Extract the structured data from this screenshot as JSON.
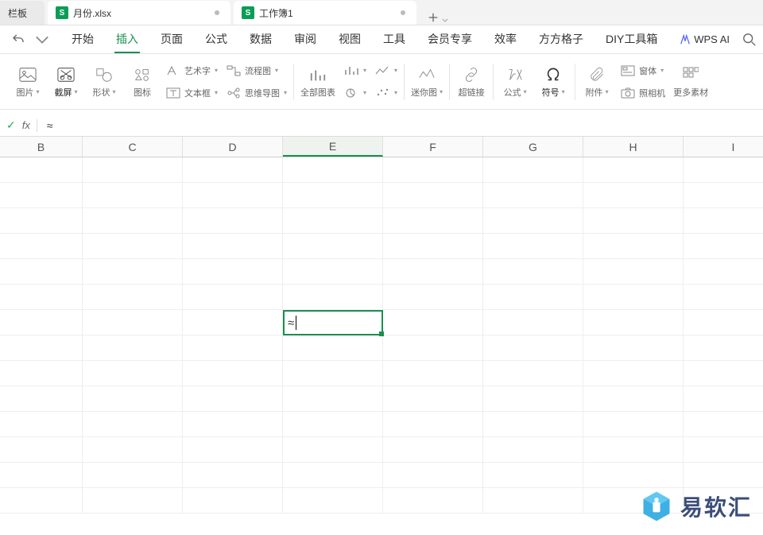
{
  "tabs": {
    "partial_label": "栏板",
    "file1": "月份.xlsx",
    "file2": "工作簿1",
    "s_icon": "S"
  },
  "menu": {
    "items": [
      "开始",
      "插入",
      "页面",
      "公式",
      "数据",
      "审阅",
      "视图",
      "工具",
      "会员专享",
      "效率",
      "方方格子",
      "DIY工具箱"
    ],
    "active_index": 1,
    "wps_ai": "WPS AI"
  },
  "ribbon": {
    "image": "图片",
    "screenshot": "截屏",
    "shapes": "形状",
    "icons": "图标",
    "wordart": "艺术字",
    "textbox": "文本框",
    "flowchart": "流程图",
    "mindmap": "思维导图",
    "allcharts": "全部图表",
    "chart_a": "",
    "chart_b": "",
    "sparkline": "迷你图",
    "hyperlink": "超链接",
    "formula": "公式",
    "symbol": "符号",
    "attachment": "附件",
    "window": "窗体",
    "camera": "照相机",
    "more": "更多素材"
  },
  "formula_bar": {
    "fx": "fx",
    "value": "≈"
  },
  "grid": {
    "columns": [
      "B",
      "C",
      "D",
      "E",
      "F",
      "G",
      "H",
      "I"
    ],
    "selected_col_index": 3,
    "row_count": 14,
    "active_cell_value": "≈"
  },
  "watermark": {
    "text": "易软汇"
  }
}
